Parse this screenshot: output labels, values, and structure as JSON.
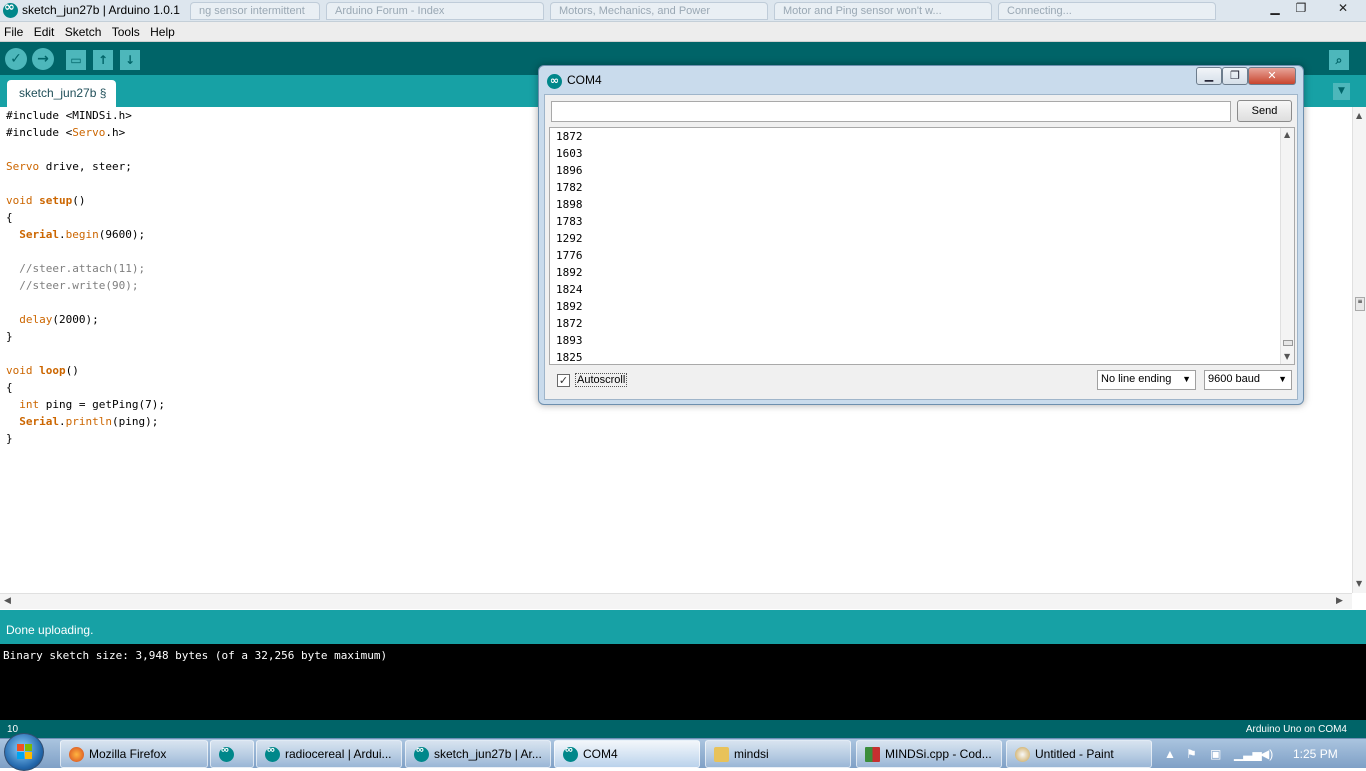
{
  "window": {
    "title": "sketch_jun27b | Arduino 1.0.1",
    "ghost_tabs": [
      "ng sensor intermittent",
      "Arduino Forum - Index",
      "Motors, Mechanics, and Power",
      "Motor and Ping sensor won't w...",
      "Connecting..."
    ]
  },
  "menu": [
    "File",
    "Edit",
    "Sketch",
    "Tools",
    "Help"
  ],
  "toolbar": {
    "icons": [
      "verify-icon",
      "upload-icon",
      "new-icon",
      "open-icon",
      "save-icon",
      "serial-monitor-icon"
    ]
  },
  "tab": {
    "label": "sketch_jun27b §"
  },
  "code": {
    "line1": "#include <MINDSi.h>",
    "line2_pre": "#include <",
    "line2_kw": "Servo",
    "line2_post": ".h>",
    "line4_kw": "Servo",
    "line4_post": " drive, steer;",
    "line6_kw": "void",
    "line6_fn": "setup",
    "line6_post": "()",
    "brace_open": "{",
    "brace_close": "}",
    "line8_kw": "Serial",
    "line8_fn": "begin",
    "line8_post": "(9600);",
    "line10": "//steer.attach(11);",
    "line11": "//steer.write(90);",
    "line13_fn": "delay",
    "line13_post": "(2000);",
    "line16_kw": "void",
    "line16_fn": "loop",
    "line16_post": "()",
    "line18_kw": "int",
    "line18_post": " ping = getPing(7);",
    "line19_kw": "Serial",
    "line19_fn": "println",
    "line19_post": "(ping);"
  },
  "status": {
    "text": "Done uploading."
  },
  "console": {
    "text": "Binary sketch size: 3,948 bytes (of a 32,256 byte maximum)"
  },
  "footer": {
    "line_number": "10",
    "board": "Arduino Uno on COM4"
  },
  "serial_monitor": {
    "title": "COM4",
    "input_value": "",
    "send_label": "Send",
    "lines": [
      "1872",
      "1603",
      "1896",
      "1782",
      "1898",
      "1783",
      "1292",
      "1776",
      "1892",
      "1824",
      "1892",
      "1872",
      "1893",
      "1825"
    ],
    "autoscroll_label": "Autoscroll",
    "autoscroll_checked": true,
    "line_ending": "No line ending",
    "baud": "9600 baud"
  },
  "taskbar": {
    "items": [
      {
        "label": "Mozilla Firefox",
        "icon": "firefox-icon"
      },
      {
        "label": "",
        "icon": "arduino-icon"
      },
      {
        "label": "radiocereal | Ardui...",
        "icon": "arduino-icon"
      },
      {
        "label": "sketch_jun27b | Ar...",
        "icon": "arduino-icon"
      },
      {
        "label": "COM4",
        "icon": "arduino-icon"
      },
      {
        "label": "mindsi",
        "icon": "folder-icon"
      },
      {
        "label": "MINDSi.cpp - Cod...",
        "icon": "codeblocks-icon"
      },
      {
        "label": "Untitled - Paint",
        "icon": "paint-icon"
      }
    ],
    "clock": "1:25 PM"
  },
  "colors": {
    "teal_dark": "#006468",
    "teal_light": "#17a1a5",
    "keyword": "#cc6600",
    "comment": "#7e7e7e"
  }
}
